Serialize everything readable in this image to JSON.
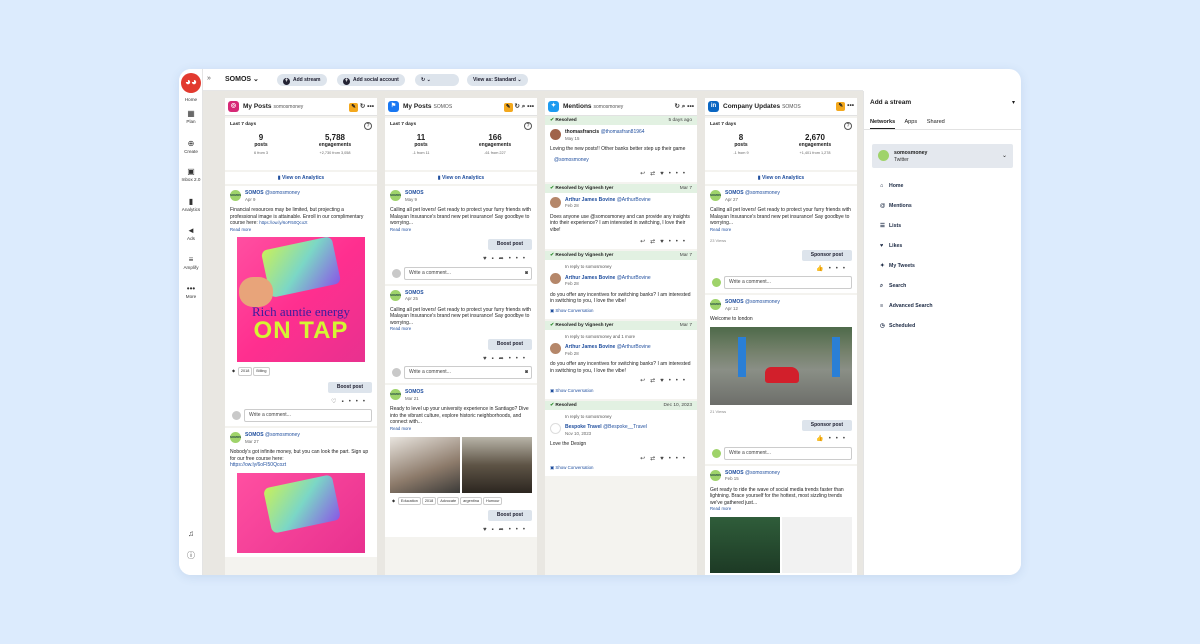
{
  "topbar": {
    "org": "SOMOS",
    "add_stream": "Add stream",
    "add_social_account": "Add social account",
    "view_as": "View as: Standard"
  },
  "sidebar": {
    "items": [
      {
        "label": "Home",
        "icon": "home-icon"
      },
      {
        "label": "Plan",
        "icon": "calendar-icon"
      },
      {
        "label": "Create",
        "icon": "plus-circle-icon"
      },
      {
        "label": "Inbox 2.0",
        "icon": "inbox-icon"
      },
      {
        "label": "Analytics",
        "icon": "bar-chart-icon"
      },
      {
        "label": "Ads",
        "icon": "megaphone-icon"
      },
      {
        "label": "Amplify",
        "icon": "amplify-icon"
      },
      {
        "label": "More",
        "icon": "more-icon"
      }
    ]
  },
  "columns": {
    "ig": {
      "title": "My Posts",
      "account": "somosmoney",
      "stats": {
        "period": "Last 7 days",
        "posts": "9",
        "posts_label": "posts",
        "posts_from": "6 from 3",
        "engagements": "5,788",
        "engagements_label": "engagements",
        "engagements_from": "+2,730 from 3,058"
      },
      "analytics": "View on Analytics",
      "post1": {
        "author": "SOMOS",
        "handle": "@somosmoney",
        "date": "Apr 9",
        "text": "Financial resources may be limited, but projecting a professional image is attainable. Enroll in our complimentary course here:",
        "link": "https://ow.ly/6oFI50Qcozt",
        "read_more": "Read more",
        "promo_l1": "Rich auntie energy",
        "promo_l2": "ON TAP",
        "tags": [
          "2018",
          "Billing"
        ],
        "boost": "Boost post",
        "comment": "Write a comment..."
      },
      "post2": {
        "author": "SOMOS",
        "handle": "@somosmoney",
        "date": "Mar 27",
        "text": "Nobody's got infinite money, but you can look the part. Sign up for our free course here:",
        "link": "https://ow.ly/6oFI50Qcozt"
      }
    },
    "fb": {
      "title": "My Posts",
      "account": "SOMOS",
      "stats": {
        "period": "Last 7 days",
        "posts": "11",
        "posts_label": "posts",
        "posts_from": "-1 from 11",
        "engagements": "166",
        "engagements_label": "engagements",
        "engagements_from": "-61 from 227"
      },
      "analytics": "View on Analytics",
      "post1": {
        "author": "SOMOS",
        "date": "May 9",
        "text": "Calling all pet lovers! Get ready to protect your furry friends with Malayan Insurance's brand new pet insurance! Say goodbye to worrying...",
        "read_more": "Read more",
        "boost": "Boost post",
        "comment": "Write a comment..."
      },
      "post2": {
        "author": "SOMOS",
        "date": "Apr 25",
        "text": "Calling all pet lovers! Get ready to protect your furry friends with Malayan Insurance's brand new pet insurance! Say goodbye to worrying...",
        "read_more": "Read more",
        "boost": "Boost post",
        "comment": "Write a comment..."
      },
      "post3": {
        "author": "SOMOS",
        "date": "Mar 21",
        "text": "Ready to level up your university experience in Santiago? Dive into the vibrant culture, explore historic neighborhoods, and connect with...",
        "read_more": "Read more",
        "tags": [
          "Education",
          "2018",
          "Advocate",
          "argentina",
          "Humour"
        ],
        "boost": "Boost post"
      }
    },
    "tw": {
      "title": "Mentions",
      "account": "somosmoney",
      "m1": {
        "status": "Resolved",
        "date": "5 days ago",
        "name": "thomasfrancis",
        "handle": "@thomasfran81964",
        "when": "May 15",
        "text": "Loving the new posts!! Other banks better step up their game",
        "mention": "@somosmoney"
      },
      "m2": {
        "status": "Resolved by Vignesh Iyer",
        "date": "Mar 7",
        "name": "Arthur James Bovine",
        "handle": "@ArthurBovine",
        "when": "Feb 28",
        "text": "Does anyone use @somosmoney and can provide any insights into their experience? I am interested in switching, I love their vibe!"
      },
      "m3": {
        "status": "Resolved by Vignesh Iyer",
        "date": "Mar 7",
        "reply": "In reply to somosmoney",
        "name": "Arthur James Bovine",
        "handle": "@ArthurBovine",
        "when": "Feb 28",
        "text": "do you offer any incentives for switching banks? I am interested in switching to you, I love the vibe!",
        "show": "Show Conversation"
      },
      "m4": {
        "status": "Resolved by Vignesh Iyer",
        "date": "Mar 7",
        "reply": "In reply to somosmoney and 1 more",
        "name": "Arthur James Bovine",
        "handle": "@ArthurBovine",
        "when": "Feb 28",
        "text": "do you offer any incentives for switching banks? I am interested in switching to you, I love the vibe!",
        "show": "Show Conversation"
      },
      "m5": {
        "status": "Resolved",
        "date": "Dec 10, 2023",
        "reply": "In reply to somosmoney",
        "name": "Bespoke Travel",
        "handle": "@Bespoke__Travel",
        "when": "Nov 10, 2023",
        "text": "Love the Design",
        "show": "Show Conversation"
      }
    },
    "li": {
      "title": "Company Updates",
      "account": "SOMOS",
      "stats": {
        "period": "Last 7 days",
        "posts": "8",
        "posts_label": "posts",
        "posts_from": "-1 from 9",
        "engagements": "2,670",
        "engagements_label": "engagements",
        "engagements_from": "+1,401 from 1,278"
      },
      "analytics": "View on Analytics",
      "post1": {
        "author": "SOMOS",
        "handle": "@somosmoney",
        "date": "Apr 27",
        "text": "Calling all pet lovers! Get ready to protect your furry friends with Malayan Insurance's brand new pet insurance! Say goodbye to worrying...",
        "read_more": "Read more",
        "views": "23 Views",
        "sponsor": "Sponsor post",
        "comment": "Write a comment..."
      },
      "post2": {
        "author": "SOMOS",
        "handle": "@somosmoney",
        "date": "Apr 12",
        "text": "Welcome to london",
        "views": "21 Views",
        "sponsor": "Sponsor post",
        "comment": "Write a comment..."
      },
      "post3": {
        "author": "SOMOS",
        "handle": "@somosmoney",
        "date": "Feb 15",
        "text": "Get ready to ride the wave of social media trends faster than lightning. Brace yourself for the hottest, most sizzling trends we've gathered just...",
        "read_more": "Read more"
      }
    }
  },
  "right_panel": {
    "title": "Add a stream",
    "tabs": [
      "Networks",
      "Apps",
      "Shared"
    ],
    "account_name": "somosmoney",
    "account_network": "Twitter",
    "streams": [
      {
        "label": "Home",
        "icon": "home-icon"
      },
      {
        "label": "Mentions",
        "icon": "at-icon"
      },
      {
        "label": "Lists",
        "icon": "list-icon"
      },
      {
        "label": "Likes",
        "icon": "heart-icon"
      },
      {
        "label": "My Tweets",
        "icon": "tweet-icon"
      },
      {
        "label": "Search",
        "icon": "search-icon"
      },
      {
        "label": "Advanced Search",
        "icon": "filter-icon"
      },
      {
        "label": "Scheduled",
        "icon": "clock-icon"
      }
    ]
  },
  "colors": {
    "instagram": "#d62976",
    "facebook": "#1877f2",
    "twitter": "#1d9bf0",
    "linkedin": "#0a66c2",
    "accent": "#f3a81d",
    "resolved_bg": "#e2f1e2"
  }
}
